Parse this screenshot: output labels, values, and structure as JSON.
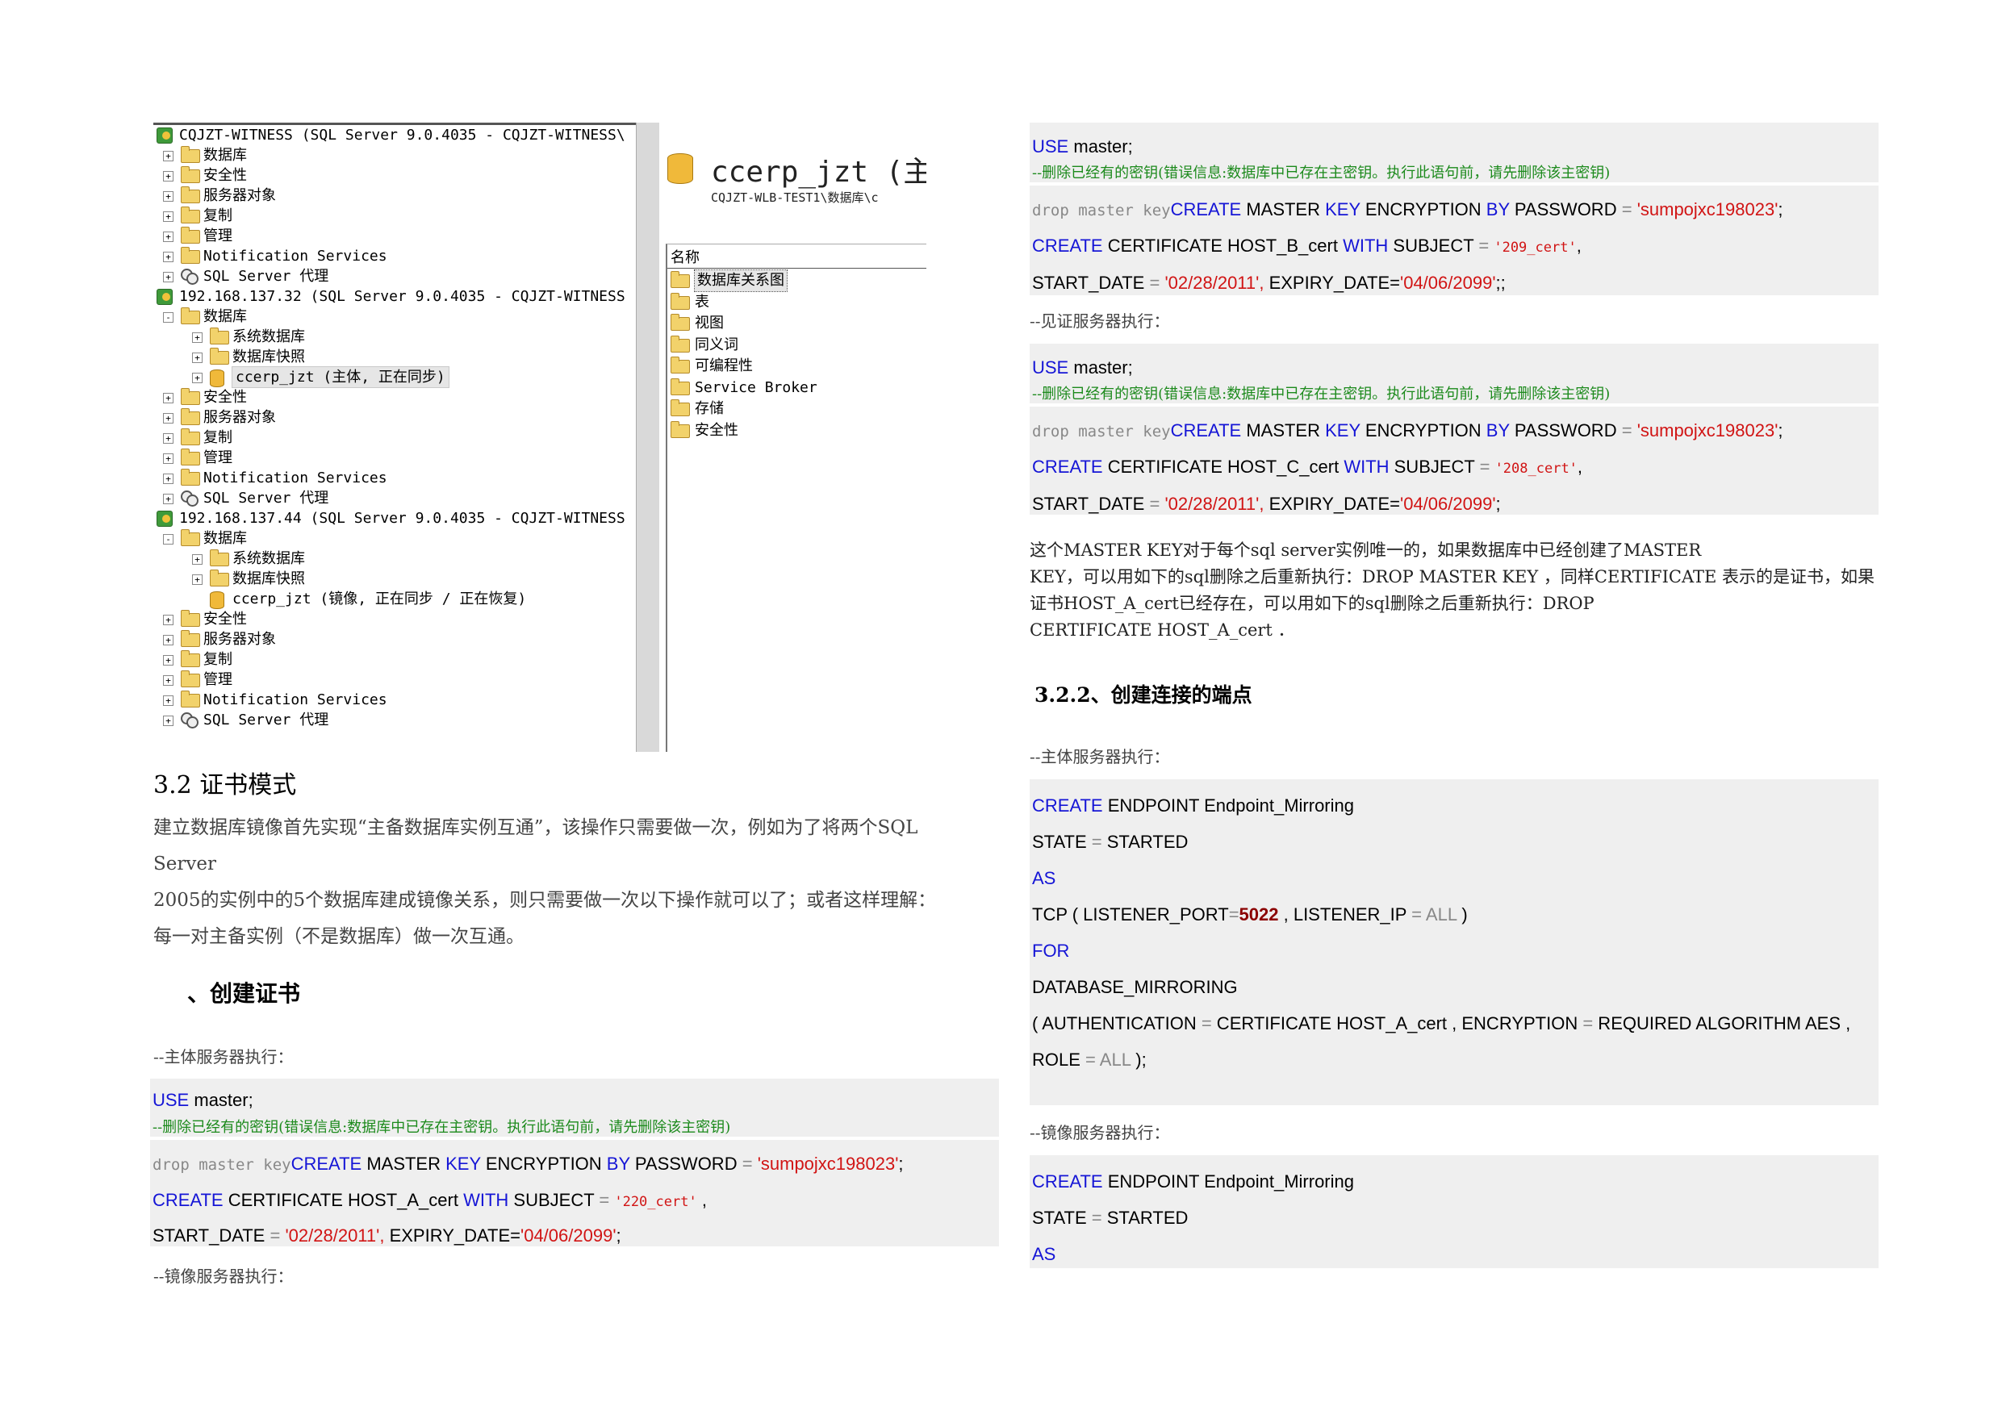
{
  "screenshot": {
    "tree": [
      {
        "indent": 0,
        "expander": "",
        "icon": "server",
        "label": "CQJZT-WITNESS (SQL Server 9.0.4035 - CQJZT-WITNESS\\"
      },
      {
        "indent": 1,
        "expander": "+",
        "icon": "folder",
        "label": "数据库"
      },
      {
        "indent": 1,
        "expander": "+",
        "icon": "folder",
        "label": "安全性"
      },
      {
        "indent": 1,
        "expander": "+",
        "icon": "folder",
        "label": "服务器对象"
      },
      {
        "indent": 1,
        "expander": "+",
        "icon": "folder",
        "label": "复制"
      },
      {
        "indent": 1,
        "expander": "+",
        "icon": "folder",
        "label": "管理"
      },
      {
        "indent": 1,
        "expander": "+",
        "icon": "folder",
        "label": "Notification Services"
      },
      {
        "indent": 1,
        "expander": "+",
        "icon": "agent",
        "label": "SQL Server 代理"
      },
      {
        "indent": 0,
        "expander": "",
        "icon": "server",
        "label": "192.168.137.32 (SQL Server 9.0.4035 - CQJZT-WITNESS"
      },
      {
        "indent": 1,
        "expander": "-",
        "icon": "folder",
        "label": "数据库"
      },
      {
        "indent": 2,
        "expander": "+",
        "icon": "folder",
        "label": "系统数据库"
      },
      {
        "indent": 2,
        "expander": "+",
        "icon": "folder",
        "label": "数据库快照"
      },
      {
        "indent": 2,
        "expander": "+",
        "icon": "db",
        "label": "ccerp_jzt (主体, 正在同步)",
        "selected": true
      },
      {
        "indent": 1,
        "expander": "+",
        "icon": "folder",
        "label": "安全性"
      },
      {
        "indent": 1,
        "expander": "+",
        "icon": "folder",
        "label": "服务器对象"
      },
      {
        "indent": 1,
        "expander": "+",
        "icon": "folder",
        "label": "复制"
      },
      {
        "indent": 1,
        "expander": "+",
        "icon": "folder",
        "label": "管理"
      },
      {
        "indent": 1,
        "expander": "+",
        "icon": "folder",
        "label": "Notification Services"
      },
      {
        "indent": 1,
        "expander": "+",
        "icon": "agent",
        "label": "SQL Server 代理"
      },
      {
        "indent": 0,
        "expander": "",
        "icon": "server",
        "label": "192.168.137.44 (SQL Server 9.0.4035 - CQJZT-WITNESS"
      },
      {
        "indent": 1,
        "expander": "-",
        "icon": "folder",
        "label": "数据库"
      },
      {
        "indent": 2,
        "expander": "+",
        "icon": "folder",
        "label": "系统数据库"
      },
      {
        "indent": 2,
        "expander": "+",
        "icon": "folder",
        "label": "数据库快照"
      },
      {
        "indent": 2,
        "expander": "",
        "icon": "db",
        "label": "ccerp_jzt (镜像, 正在同步 / 正在恢复)"
      },
      {
        "indent": 1,
        "expander": "+",
        "icon": "folder",
        "label": "安全性"
      },
      {
        "indent": 1,
        "expander": "+",
        "icon": "folder",
        "label": "服务器对象"
      },
      {
        "indent": 1,
        "expander": "+",
        "icon": "folder",
        "label": "复制"
      },
      {
        "indent": 1,
        "expander": "+",
        "icon": "folder",
        "label": "管理"
      },
      {
        "indent": 1,
        "expander": "+",
        "icon": "folder",
        "label": "Notification Services"
      },
      {
        "indent": 1,
        "expander": "+",
        "icon": "agent",
        "label": "SQL Server 代理"
      }
    ],
    "detail_title": "ccerp_jzt (主",
    "detail_path": "CQJZT-WLB-TEST1\\数据库\\c",
    "list_header": "名称",
    "list_items": [
      "数据库关系图",
      "表",
      "视图",
      "同义词",
      "可编程性",
      "Service Broker",
      "存储",
      "安全性"
    ]
  },
  "left": {
    "section_title": "3.2 证书模式",
    "para_lines": [
      "建立数据库镜像首先实现“主备数据库实例互通”，该操作只需要做一次，例如为了将两个SQL",
      "Server",
      "2005的实例中的5个数据库建成镜像关系，则只需要做一次以下操作就可以了；或者这样理解：",
      "每一对主备实例（不是数据库）做一次互通。"
    ],
    "sub_title": "、创建证书",
    "principal_comment": "--主体服务器执行：",
    "mirror_comment": "--镜像服务器执行：",
    "cert_name": "HOST_A_cert",
    "subject": "'220_cert'",
    "expiry_tail": ";"
  },
  "right": {
    "block1": {
      "cert_name": "HOST_B_cert",
      "subject": "'209_cert'",
      "expiry_tail": ";;"
    },
    "witness_comment": "--见证服务器执行：",
    "block2": {
      "cert_name": "HOST_C_cert",
      "subject": "'208_cert'",
      "expiry_tail": ";"
    },
    "note_lines": [
      "这个MASTER KEY对于每个sql server实例唯一的，如果数据库中已经创建了MASTER",
      "KEY，可以用如下的sql删除之后重新执行：DROP MASTER KEY ，同样CERTIFICATE 表示的是证书，如果",
      "证书HOST_A_cert已经存在，可以用如下的sql删除之后重新执行：DROP",
      "CERTIFICATE HOST_A_cert ．"
    ],
    "sub_title": "3.2.2、创建连接的端点",
    "principal_comment": "--主体服务器执行：",
    "mirror_comment": "--镜像服务器执行：",
    "endpoint": {
      "l1_kw": "CREATE",
      "l1_rest": " ENDPOINT Endpoint_Mirroring",
      "l2": "STATE",
      "l2_val": "STARTED",
      "l3": "AS",
      "l4a": "TCP ( LISTENER_PORT",
      "l4_port": "5022",
      "l4b": " , LISTENER_IP ",
      "l4_all": "ALL",
      "l4c": " )",
      "l5": "FOR",
      "l6": "DATABASE_MIRRORING",
      "l7a": "( AUTHENTICATION ",
      "l7b": " CERTIFICATE HOST_A_cert , ENCRYPTION ",
      "l7c": " REQUIRED ALGORITHM AES ,",
      "l8a": "ROLE ",
      "l8_all": "ALL",
      "l8b": " );"
    }
  },
  "sql": {
    "use_kw": "USE",
    "use_rest": " master;",
    "drop_comment": "--删除已经有的密钥(错误信息:数据库中已存在主密钥。执行此语句前，请先删除该主密钥)",
    "drop_mono": "drop master key",
    "create_kw": "CREATE",
    "master_key_mid": " MASTER ",
    "key_kw": "KEY",
    "encryption": " ENCRYPTION ",
    "by_kw": "BY",
    "password": " PASSWORD ",
    "pwd": "'sumpojxc198023'",
    "semi": ";",
    "cert_kw": " CERTIFICATE ",
    "with_kw": "WITH",
    "subject_kw": " SUBJECT ",
    "start": "START_DATE ",
    "start_val": "'02/28/2011',",
    "expiry": "  EXPIRY_DATE=",
    "expiry_val": "'04/06/2099'",
    "eq": "=",
    "comma": ","
  }
}
